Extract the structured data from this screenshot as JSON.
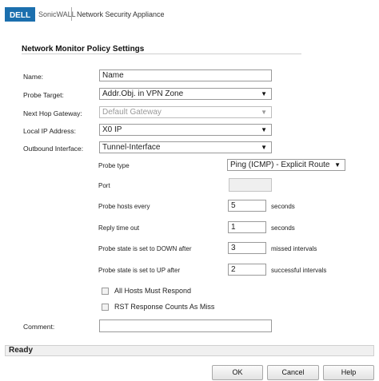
{
  "header": {
    "logo_text": "DELL",
    "brand": "SonicWALL",
    "subtitle": "Network Security Appliance"
  },
  "page_title": "Network Monitor Policy Settings",
  "form": {
    "name": {
      "label": "Name:",
      "value": "Name"
    },
    "probe_target": {
      "label": "Probe Target:",
      "value": "Addr.Obj. in VPN Zone"
    },
    "next_hop_gateway": {
      "label": "Next Hop Gateway:",
      "value": "Default Gateway"
    },
    "local_ip": {
      "label": "Local IP Address:",
      "value": "X0 IP"
    },
    "outbound_interface": {
      "label": "Outbound Interface:",
      "value": "Tunnel-Interface"
    },
    "probe_type": {
      "label": "Probe type",
      "value": "Ping (ICMP) - Explicit Route"
    },
    "port": {
      "label": "Port",
      "value": ""
    },
    "probe_hosts_every": {
      "label": "Probe hosts every",
      "value": "5",
      "unit": "seconds"
    },
    "reply_time_out": {
      "label": "Reply time out",
      "value": "1",
      "unit": "seconds"
    },
    "state_down_after": {
      "label": "Probe state is set to DOWN after",
      "value": "3",
      "unit": "missed intervals"
    },
    "state_up_after": {
      "label": "Probe state is set to UP after",
      "value": "2",
      "unit": "successful intervals"
    },
    "all_hosts_must_respond": {
      "label": "All Hosts Must Respond",
      "checked": false
    },
    "rst_response": {
      "label": "RST Response Counts As Miss",
      "checked": false
    },
    "comment": {
      "label": "Comment:",
      "value": ""
    }
  },
  "status": "Ready",
  "buttons": {
    "ok": "OK",
    "cancel": "Cancel",
    "help": "Help"
  }
}
